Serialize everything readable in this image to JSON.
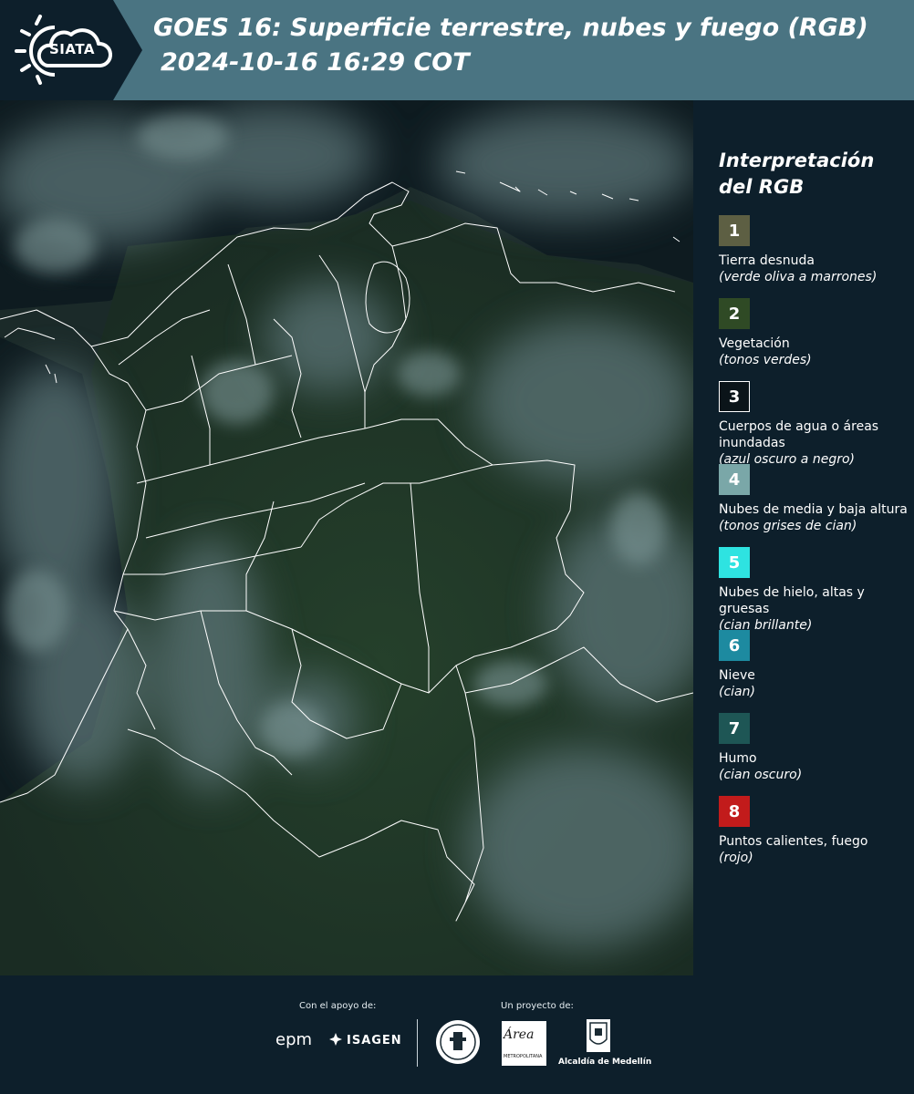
{
  "header": {
    "logo_text": "SIATA",
    "title_line1": "GOES 16: Superficie terrestre, nubes y fuego (RGB)",
    "title_line2": "2024-10-16 16:29 COT"
  },
  "map": {
    "name": "Colombia GOES-16 land/cloud/fire RGB composite",
    "colors": {
      "land": "#1d2f24",
      "ocean": "#0f1d22",
      "cloud": "#5f787a",
      "border": "#ffffff"
    }
  },
  "legend": {
    "title": "Interpretación del RGB",
    "items": [
      {
        "number": "1",
        "label": "Tierra desnuda",
        "description": "(verde oliva a marrones)",
        "color": "#5d5f43",
        "outlined": false
      },
      {
        "number": "2",
        "label": "Vegetación",
        "description": "(tonos verdes)",
        "color": "#2f4a25",
        "outlined": false
      },
      {
        "number": "3",
        "label": "Cuerpos de agua o áreas inundadas",
        "description": "(azul oscuro a negro)",
        "color": "#0b1419",
        "outlined": true
      },
      {
        "number": "4",
        "label": "Nubes de media y baja altura",
        "description": "(tonos grises de cian)",
        "color": "#7aa7a8",
        "outlined": false
      },
      {
        "number": "5",
        "label": "Nubes de hielo, altas y gruesas",
        "description": "(cian brillante)",
        "color": "#2ee3e1",
        "outlined": false
      },
      {
        "number": "6",
        "label": "Nieve",
        "description": "(cian)",
        "color": "#1d8aa0",
        "outlined": false
      },
      {
        "number": "7",
        "label": "Humo",
        "description": "(cian oscuro)",
        "color": "#1e5655",
        "outlined": false
      },
      {
        "number": "8",
        "label": "Puntos calientes, fuego",
        "description": "(rojo)",
        "color": "#c21b1b",
        "outlined": false
      }
    ]
  },
  "footer": {
    "support_caption": "Con el apoyo de:",
    "project_caption": "Un proyecto de:",
    "support_logos": [
      "epm",
      "ISAGEN"
    ],
    "project_logos": [
      "Área Metropolitana",
      "Alcaldía de Medellín"
    ],
    "epm_text": "epm",
    "isagen_text": "ISAGEN",
    "area_text": "Área",
    "area_sub": "METROPOLITANA",
    "alcaldia_text": "Alcaldía de Medellín"
  }
}
